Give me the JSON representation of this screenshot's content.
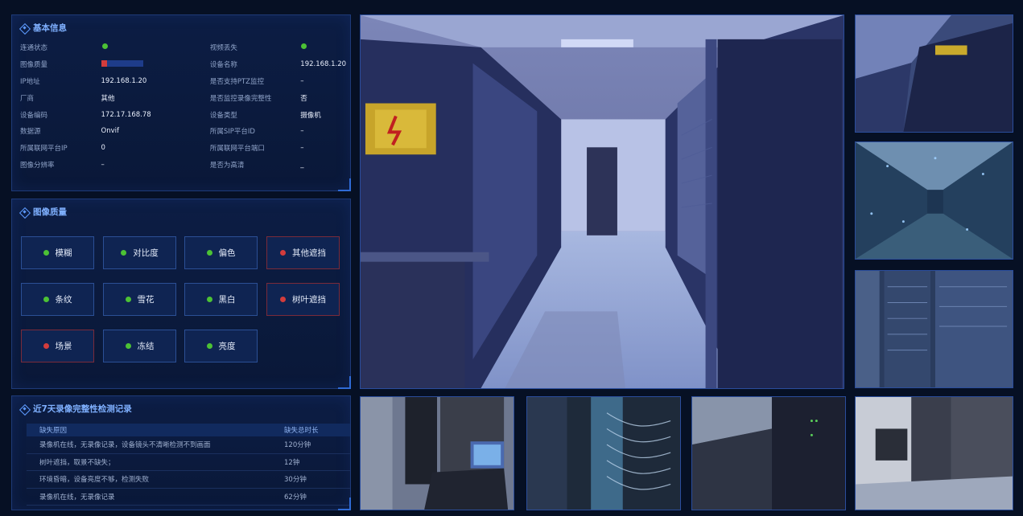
{
  "basic_info": {
    "title": "基本信息",
    "rows": [
      {
        "l1": "连通状态",
        "v1": "",
        "v1_type": "dot",
        "l2": "视频丢失",
        "v2": "",
        "v2_type": "dot"
      },
      {
        "l1": "图像质量",
        "v1": "",
        "v1_type": "bar",
        "l2": "设备名称",
        "v2": "192.168.1.20"
      },
      {
        "l1": "IP地址",
        "v1": "192.168.1.20",
        "l2": "是否支持PTZ监控",
        "v2": "–"
      },
      {
        "l1": "厂商",
        "v1": "其他",
        "l2": "是否监控录像完整性",
        "v2": "否"
      },
      {
        "l1": "设备编码",
        "v1": "172.17.168.78",
        "l2": "设备类型",
        "v2": "摄像机"
      },
      {
        "l1": "数据源",
        "v1": "Onvif",
        "l2": "所属SIP平台ID",
        "v2": "–"
      },
      {
        "l1": "所属联网平台IP",
        "v1": "0",
        "l2": "所属联网平台端口",
        "v2": "–"
      },
      {
        "l1": "图像分辨率",
        "v1": "–",
        "l2": "是否为高清",
        "v2": "_"
      }
    ],
    "image_quality_level": 0.15
  },
  "image_quality": {
    "title": "图像质量",
    "items": [
      {
        "label": "模糊",
        "status": "ok"
      },
      {
        "label": "对比度",
        "status": "ok"
      },
      {
        "label": "偏色",
        "status": "ok"
      },
      {
        "label": "其他遮挡",
        "status": "bad"
      },
      {
        "label": "条纹",
        "status": "ok"
      },
      {
        "label": "雪花",
        "status": "ok"
      },
      {
        "label": "黑白",
        "status": "ok"
      },
      {
        "label": "树叶遮挡",
        "status": "bad"
      },
      {
        "label": "场景",
        "status": "bad"
      },
      {
        "label": "冻结",
        "status": "ok"
      },
      {
        "label": "亮度",
        "status": "ok"
      }
    ]
  },
  "records": {
    "title": "近7天录像完整性检测记录",
    "header": {
      "reason": "缺失原因",
      "duration": "缺失总时长"
    },
    "rows": [
      {
        "reason": "录像机在线，无录像记录，设备镜头不清晰检测不到画面",
        "duration": "120分钟"
      },
      {
        "reason": "树叶遮挡，取景不缺失；",
        "duration": "12钟"
      },
      {
        "reason": "环境昏暗，设备亮度不够，检测失败",
        "duration": "30分钟"
      },
      {
        "reason": "录像机在线，无录像记录",
        "duration": "62分钟"
      }
    ]
  },
  "colors": {
    "ok": "#4cc235",
    "bad": "#d33c3c",
    "accent": "#5e9bff"
  }
}
